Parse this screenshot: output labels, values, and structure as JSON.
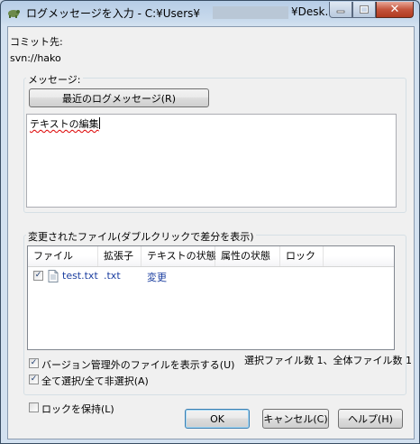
{
  "window": {
    "title": "ログメッセージを入力 - C:¥Users¥",
    "title_tail": "¥Desk...",
    "caption_buttons": [
      "minimize",
      "maximize",
      "close"
    ]
  },
  "commit_to": {
    "label": "コミット先:",
    "url": "svn://hako"
  },
  "message": {
    "group_label": "メッセージ:",
    "recent_button": "最近のログメッセージ(R)",
    "text": "テキストの編集"
  },
  "changes": {
    "group_label": "変更されたファイル(ダブルクリックで差分を表示)",
    "columns": [
      "ファイル",
      "拡張子",
      "テキストの状態",
      "属性の状態",
      "ロック"
    ],
    "rows": [
      {
        "checked": true,
        "file": "test.txt",
        "ext": ".txt",
        "text_status": "変更",
        "prop_status": "",
        "lock": ""
      }
    ],
    "count_text": "選択ファイル数 1、全体ファイル数 1",
    "show_unversioned": {
      "label": "バージョン管理外のファイルを表示する(U)",
      "checked": true
    },
    "select_all": {
      "label": "全て選択/全て非選択(A)",
      "checked": true
    }
  },
  "keep_locks": {
    "label": "ロックを保持(L)",
    "checked": false
  },
  "buttons": {
    "ok": "OK",
    "cancel": "キャンセル(C)",
    "help": "ヘルプ(H)"
  }
}
